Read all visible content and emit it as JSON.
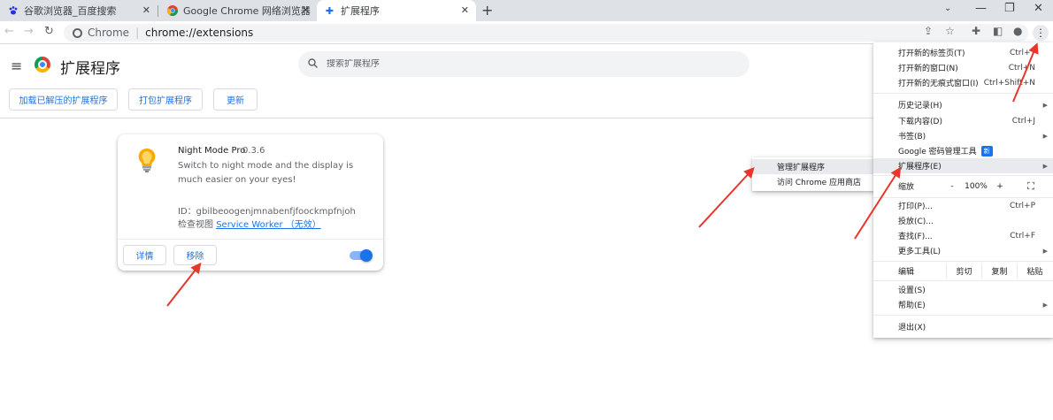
{
  "tabs": [
    {
      "label": "谷歌浏览器_百度搜索",
      "icon": "baidu-paw-icon",
      "active": false
    },
    {
      "label": "Google Chrome 网络浏览器",
      "icon": "chrome-logo-icon",
      "active": false
    },
    {
      "label": "扩展程序",
      "icon": "puzzle-icon",
      "active": true
    }
  ],
  "omnibox": {
    "chip": "Chrome",
    "separator": "|",
    "url": "chrome://extensions"
  },
  "page": {
    "title": "扩展程序",
    "search_placeholder": "搜索扩展程序",
    "buttons": {
      "load_unpacked": "加载已解压的扩展程序",
      "pack": "打包扩展程序",
      "update": "更新"
    }
  },
  "extension": {
    "name": "Night Mode Pro",
    "version": "0.3.6",
    "description": "Switch to night mode and the display is much easier on your eyes!",
    "id_label": "ID：",
    "id": "gbilbeoogenjmnabenfjfoockmpfnjoh",
    "inspect_label": "检查视图",
    "inspect_link": "Service Worker （无效）",
    "details_button": "详情",
    "remove_button": "移除",
    "enabled": true
  },
  "main_menu": {
    "items": [
      {
        "label": "打开新的标签页(T)",
        "shortcut": "Ctrl+T"
      },
      {
        "label": "打开新的窗口(N)",
        "shortcut": "Ctrl+N"
      },
      {
        "label": "打开新的无痕式窗口(I)",
        "shortcut": "Ctrl+Shift+N"
      },
      {
        "label": "历史记录(H)",
        "submenu": true
      },
      {
        "label": "下载内容(D)",
        "shortcut": "Ctrl+J"
      },
      {
        "label": "书签(B)",
        "submenu": true
      },
      {
        "label": "Google 密码管理工具",
        "badge": "新"
      },
      {
        "label": "扩展程序(E)",
        "submenu": true
      },
      {
        "label": "打印(P)...",
        "shortcut": "Ctrl+P"
      },
      {
        "label": "投放(C)..."
      },
      {
        "label": "查找(F)...",
        "shortcut": "Ctrl+F"
      },
      {
        "label": "更多工具(L)",
        "submenu": true
      },
      {
        "label": "设置(S)"
      },
      {
        "label": "帮助(E)",
        "submenu": true
      },
      {
        "label": "退出(X)"
      }
    ],
    "zoom": {
      "label": "缩放",
      "minus": "-",
      "value": "100%",
      "plus": "+",
      "fullscreen": "⛶"
    },
    "edit": {
      "label": "编辑",
      "cut": "剪切",
      "copy": "复制",
      "paste": "粘贴"
    }
  },
  "extensions_submenu": {
    "items": [
      {
        "label": "管理扩展程序"
      },
      {
        "label": "访问 Chrome 应用商店"
      }
    ]
  },
  "colors": {
    "accent": "#1a73e8",
    "annotation_arrow": "#e8362a"
  }
}
